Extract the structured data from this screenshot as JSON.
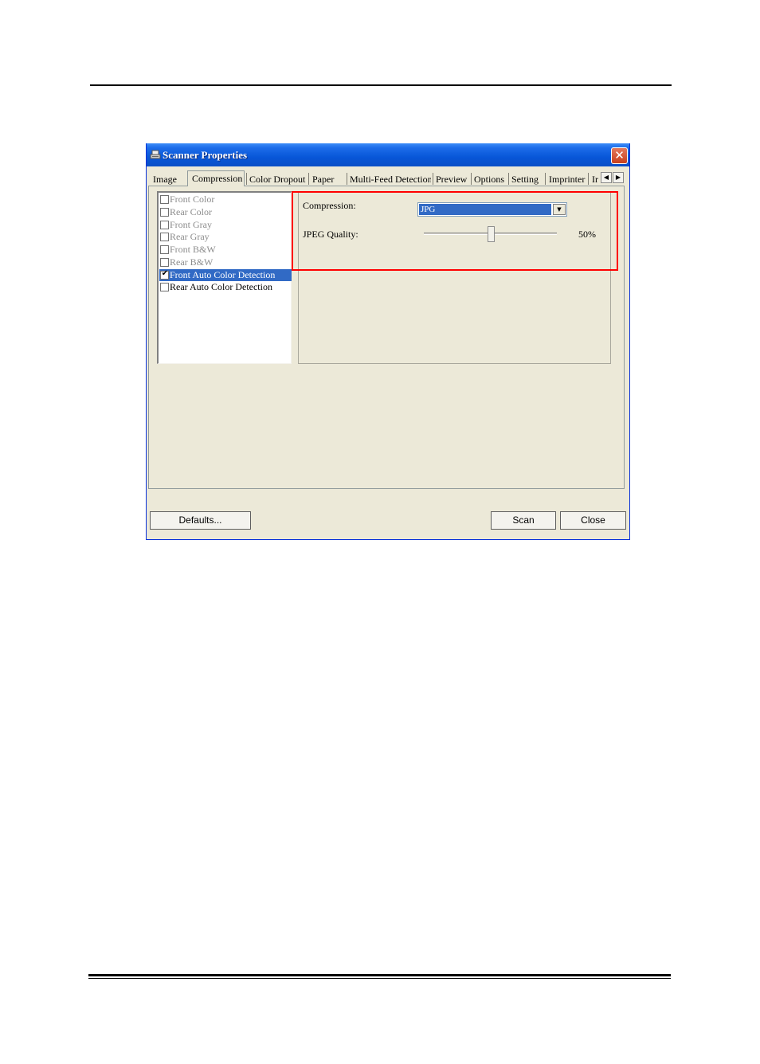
{
  "window": {
    "title": "Scanner Properties",
    "close_glyph": "✕"
  },
  "tabs": [
    {
      "label": "Image",
      "active": false
    },
    {
      "label": "Compression",
      "active": true
    },
    {
      "label": "Color Dropout",
      "active": false
    },
    {
      "label": "Paper",
      "active": false
    },
    {
      "label": "Multi-Feed Detection",
      "active": false
    },
    {
      "label": "Preview",
      "active": false
    },
    {
      "label": "Options",
      "active": false
    },
    {
      "label": "Setting",
      "active": false
    },
    {
      "label": "Imprinter",
      "active": false
    },
    {
      "label": "Ir",
      "active": false
    }
  ],
  "tab_scroll": {
    "left_glyph": "◀",
    "right_glyph": "▶"
  },
  "image_list": [
    {
      "label": "Front Color",
      "checked": false,
      "enabled": false,
      "selected": false
    },
    {
      "label": "Rear Color",
      "checked": false,
      "enabled": false,
      "selected": false
    },
    {
      "label": "Front Gray",
      "checked": false,
      "enabled": false,
      "selected": false
    },
    {
      "label": "Rear Gray",
      "checked": false,
      "enabled": false,
      "selected": false
    },
    {
      "label": "Front B&W",
      "checked": false,
      "enabled": false,
      "selected": false
    },
    {
      "label": "Rear B&W",
      "checked": false,
      "enabled": false,
      "selected": false
    },
    {
      "label": "Front Auto Color Detection",
      "checked": true,
      "enabled": true,
      "selected": true
    },
    {
      "label": "Rear Auto Color Detection",
      "checked": false,
      "enabled": true,
      "selected": false
    }
  ],
  "compression": {
    "label": "Compression:",
    "value": "JPG",
    "dropdown_glyph": "▼"
  },
  "jpeg_quality": {
    "label": "JPEG Quality:",
    "value_text": "50%",
    "level": 0.5
  },
  "buttons": {
    "defaults": "Defaults...",
    "scan": "Scan",
    "close": "Close"
  },
  "colors": {
    "titlebar": "#0856d8",
    "selection": "#316ac5",
    "highlight_box": "#ff0000",
    "dialog_bg": "#ece9d8"
  },
  "icons": {
    "title": "scanner-icon",
    "close": "close-icon",
    "check": "checkmark-icon"
  }
}
